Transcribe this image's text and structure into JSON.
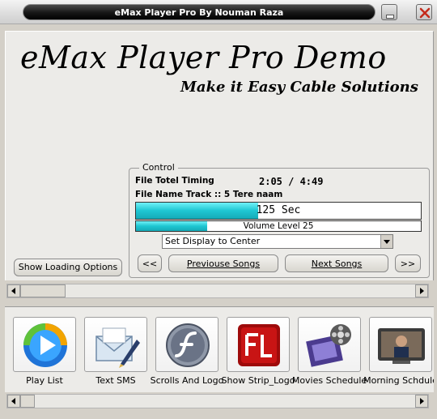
{
  "window": {
    "title": "eMax Player Pro By Nouman Raza",
    "minimize": "minimize-icon",
    "close": "close-icon"
  },
  "app": {
    "title": "eMax Player Pro Demo",
    "subtitle": "Make it Easy Cable Solutions"
  },
  "control": {
    "legend": "Control",
    "timing_label": "File Totel Timing",
    "timing_value": "2:05 / 4:49",
    "file_name": "File Name Track :: 5 Tere naam",
    "seconds_text": "125 Sec",
    "seconds_progress": 0.43,
    "volume_text": "Volume Level  25",
    "volume_progress": 0.25,
    "display_select": "Set Display to Center",
    "prev_fast": "<<",
    "prev_label": "Previouse Songs",
    "next_label": "Next Songs",
    "next_fast": ">>"
  },
  "show_loading_options": "Show Loading Options",
  "shortcuts": [
    {
      "label": "Play List",
      "icon": "windows-media-icon"
    },
    {
      "label": "Text SMS",
      "icon": "envelope-pen-icon"
    },
    {
      "label": "Scrolls And Logo",
      "icon": "flash-player-icon"
    },
    {
      "label": "Show Strip_Logo",
      "icon": "flash-fl-icon"
    },
    {
      "label": "Movies Schedule",
      "icon": "film-reel-icon"
    },
    {
      "label": "Morning Schdule",
      "icon": "tv-monitor-icon"
    }
  ],
  "colors": {
    "progress_fill": "#1ec6d2",
    "panel_bg": "#ecebe8",
    "title_bar": "#161616"
  }
}
